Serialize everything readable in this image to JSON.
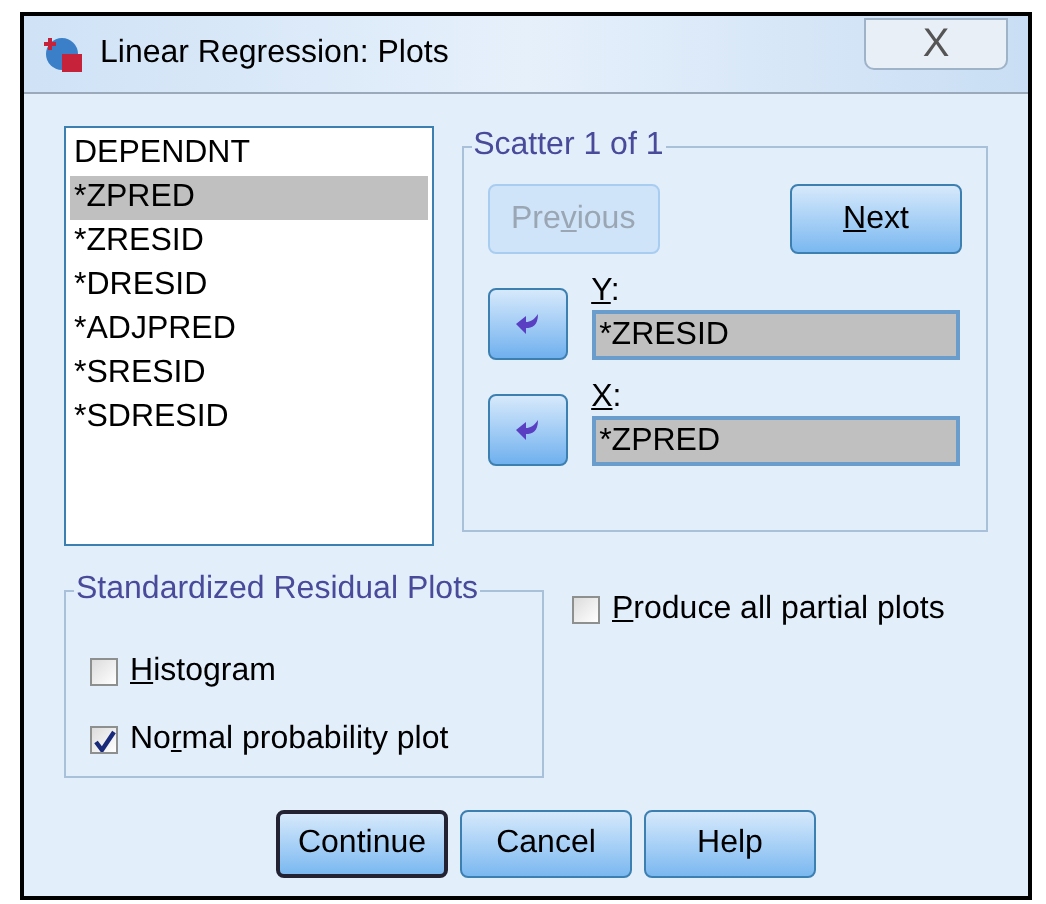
{
  "window": {
    "title": "Linear Regression: Plots",
    "close": "X"
  },
  "variables": [
    {
      "label": "DEPENDNT",
      "selected": false
    },
    {
      "label": "*ZPRED",
      "selected": true
    },
    {
      "label": "*ZRESID",
      "selected": false
    },
    {
      "label": "*DRESID",
      "selected": false
    },
    {
      "label": "*ADJPRED",
      "selected": false
    },
    {
      "label": "*SRESID",
      "selected": false
    },
    {
      "label": "*SDRESID",
      "selected": false
    }
  ],
  "scatter": {
    "title": "Scatter 1 of 1",
    "nav": [
      {
        "pre": "Pre",
        "key": "v",
        "post": "ious",
        "disabled": true
      },
      {
        "key": "N",
        "post": "ext",
        "disabled": false
      }
    ],
    "axes": [
      {
        "key": "Y",
        "post": ":",
        "value": "*ZRESID"
      },
      {
        "key": "X",
        "post": ":",
        "value": "*ZPRED"
      }
    ]
  },
  "residual_plots": {
    "title": "Standardized Residual Plots",
    "options": [
      {
        "key": "H",
        "post": "istogram",
        "checked": false
      },
      {
        "pre": "No",
        "key": "r",
        "post": "mal probability plot",
        "checked": true
      }
    ]
  },
  "partial_plots": {
    "key": "P",
    "post": "roduce all partial plots",
    "checked": false
  },
  "buttons": [
    {
      "label": "Continue",
      "default": true
    },
    {
      "label": "Cancel",
      "default": false
    },
    {
      "label": "Help",
      "default": false
    }
  ]
}
